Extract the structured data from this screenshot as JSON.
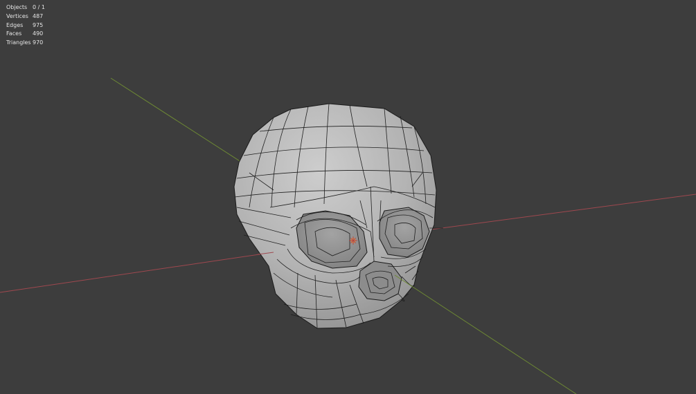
{
  "viewport": {
    "background": "#3d3d3d",
    "axis_x_color": "#a0484f",
    "axis_y_color": "#6e8a34",
    "mesh_color": "#b5b5b5",
    "wire_color": "#1a1a1a",
    "origin_color": "#e27b34",
    "origin_icon": "object-origin-icon"
  },
  "stats": [
    {
      "label": "Objects",
      "value": "0 / 1"
    },
    {
      "label": "Vertices",
      "value": "487"
    },
    {
      "label": "Edges",
      "value": "975"
    },
    {
      "label": "Faces",
      "value": "490"
    },
    {
      "label": "Triangles",
      "value": "970"
    }
  ]
}
